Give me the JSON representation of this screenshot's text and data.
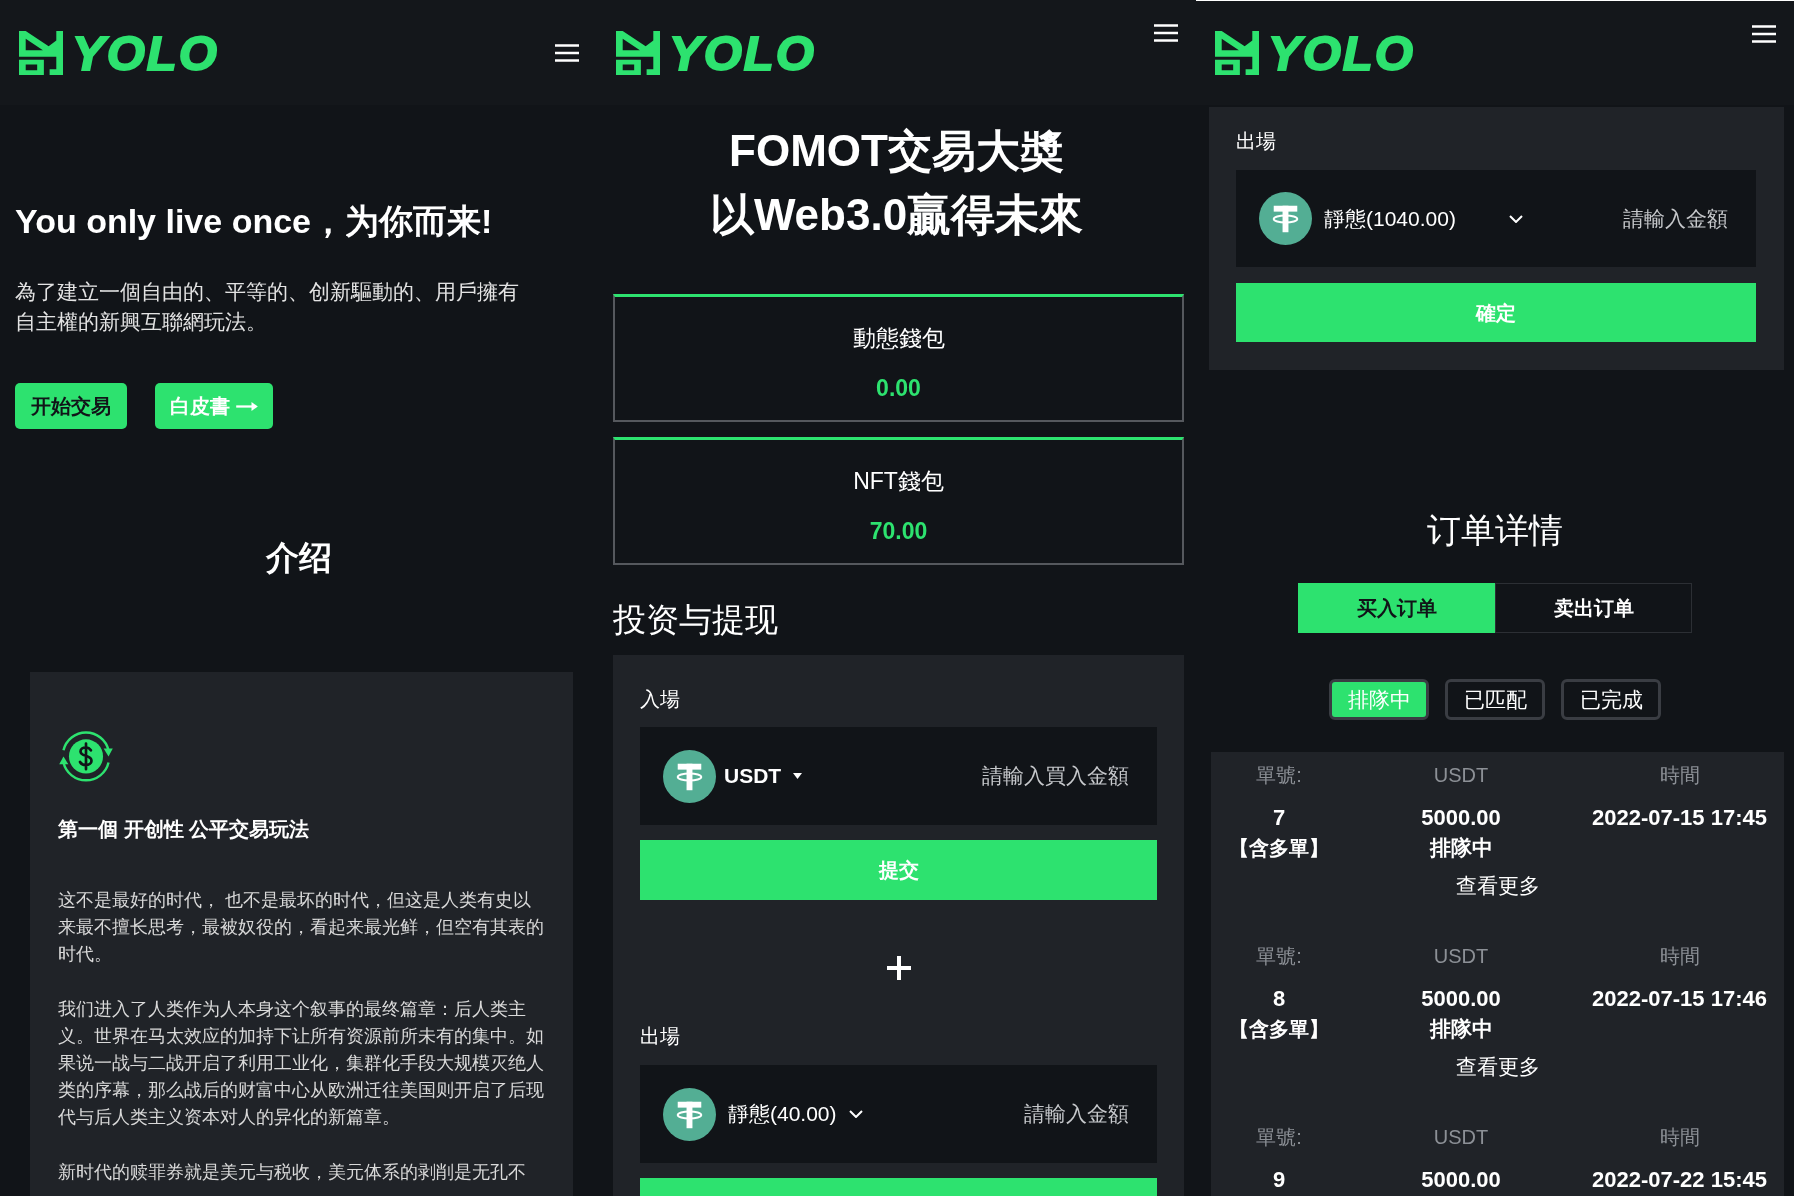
{
  "screens": [
    {
      "kind": "home",
      "logo": "YOLO",
      "hero": {
        "title": "You only live once，为你而来!",
        "text": "為了建立一個自由的、平等的、创新驅動的、用戶擁有自主權的新興互聯網玩法。",
        "buttons": [
          {
            "label": "开始交易",
            "kind": "solid"
          },
          {
            "label": "白皮書",
            "kind": "arrow"
          }
        ]
      },
      "section_title": "介绍",
      "feature": {
        "title": "第一個 开创性 公平交易玩法",
        "paragraphs": [
          "这不是最好的时代， 也不是最坏的时代，但这是人类有史以来最不擅长思考，最被奴役的，看起来最光鲜，但空有其表的时代。",
          "我们进入了人类作为人本身这个叙事的最终篇章：后人类主义。世界在马太效应的加持下让所有资源前所未有的集中。如果说一战与二战开启了利用工业化，集群化手段大规模灭绝人类的序幕，那么战后的财富中心从欧洲迁往美国则开启了后现代与后人类主义资本对人的异化的新篇章。",
          "新时代的赎罪券就是美元与税收，美元体系的剥削是无孔不"
        ]
      }
    },
    {
      "kind": "wallet",
      "logo": "YOLO",
      "title_lines": [
        "FOMOT交易大奬",
        "以Web3.0贏得未來"
      ],
      "wallets": [
        {
          "label": "動態錢包",
          "balance": "0.00"
        },
        {
          "label": "NFT錢包",
          "balance": "70.00"
        }
      ],
      "section_title": "投资与提现",
      "entry": {
        "label": "入場",
        "token": "USDT",
        "placeholder": "請輸入買入金額",
        "button": "提交"
      },
      "exit": {
        "label": "出場",
        "token": "靜態(40.00)",
        "placeholder": "請輸入金額"
      }
    },
    {
      "kind": "orders",
      "logo": "YOLO",
      "exit": {
        "label": "出場",
        "token": "靜態(1040.00)",
        "placeholder": "請輸入金額",
        "button": "確定"
      },
      "title": "订单详情",
      "tabs": [
        {
          "label": "买入订单",
          "selected": true
        },
        {
          "label": "卖出订单",
          "selected": false
        }
      ],
      "filters": [
        {
          "label": "排隊中",
          "selected": true
        },
        {
          "label": "已匹配",
          "selected": false
        },
        {
          "label": "已完成",
          "selected": false
        }
      ],
      "orders": [
        {
          "labels": [
            "單號:",
            "USDT",
            "時間"
          ],
          "number": "7",
          "tag": "【含多單】",
          "amount": "5000.00",
          "status": "排隊中",
          "time": "2022-07-15 17:45",
          "more": "查看更多"
        },
        {
          "labels": [
            "單號:",
            "USDT",
            "時間"
          ],
          "number": "8",
          "tag": "【含多單】",
          "amount": "5000.00",
          "status": "排隊中",
          "time": "2022-07-15 17:46",
          "more": "查看更多"
        },
        {
          "labels": [
            "單號:",
            "USDT",
            "時間"
          ],
          "number": "9",
          "amount": "5000.00",
          "time": "2022-07-22 15:45"
        }
      ]
    }
  ]
}
